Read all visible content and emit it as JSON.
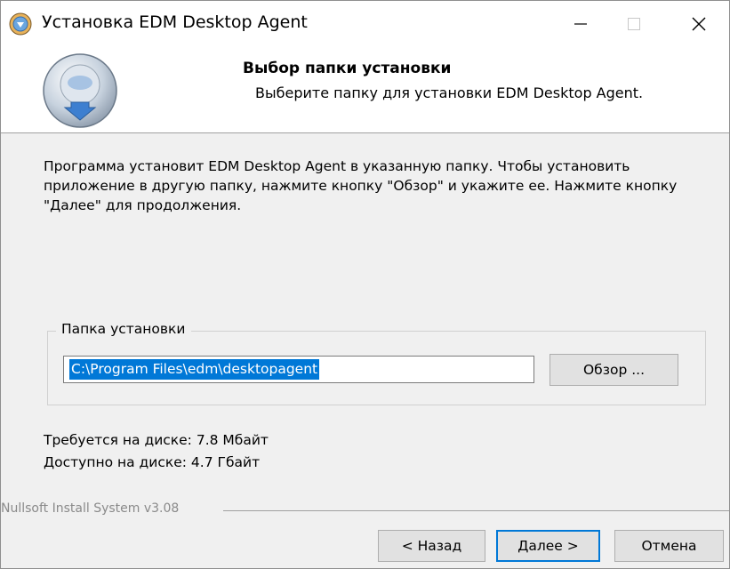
{
  "window": {
    "title": "Установка EDM Desktop Agent",
    "icon": "installer-icon",
    "controls": {
      "minimize": "minimize-icon",
      "maximize": "maximize-icon",
      "close": "close-icon"
    }
  },
  "banner": {
    "title": "Выбор папки установки",
    "subtitle": "Выберите папку для установки EDM Desktop Agent.",
    "logo": "install-disc-logo"
  },
  "intro": {
    "text": "Программа установит EDM Desktop Agent в указанную папку. Чтобы установить приложение в другую папку, нажмите кнопку \"Обзор\" и укажите ее. Нажмите кнопку \"Далее\" для продолжения."
  },
  "install_folder": {
    "group_label": "Папка установки",
    "path": "C:\\Program Files\\edm\\desktopagent",
    "browse_label": "Обзор ..."
  },
  "disk": {
    "required": "Требуется на диске: 7.8 Мбайт",
    "available": "Доступно на диске: 4.7 Гбайт"
  },
  "footer": {
    "branding": "Nullsoft Install System v3.08",
    "back_label": "< Назад",
    "next_label": "Далее >",
    "cancel_label": "Отмена"
  },
  "colors": {
    "accent": "#0078d7",
    "window_bg": "#f0f0f0",
    "banner_bg": "#ffffff"
  }
}
